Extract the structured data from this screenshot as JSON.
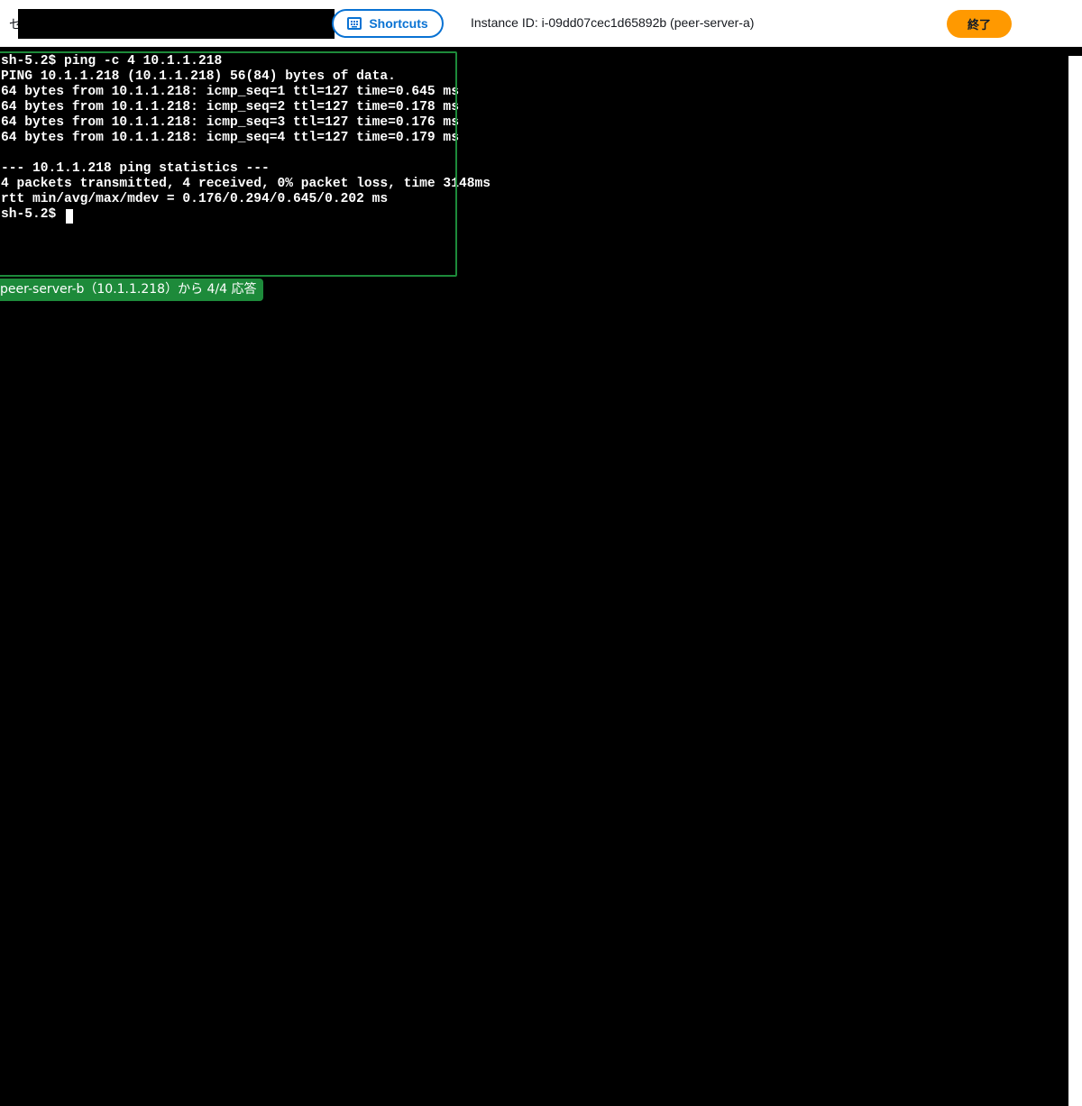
{
  "header": {
    "session_label": "セ",
    "shortcuts_label": "Shortcuts",
    "instance_info": "Instance ID: i-09dd07cec1d65892b (peer-server-a)",
    "terminate_label": "終了"
  },
  "colors": {
    "shortcuts_accent": "#0972d3",
    "terminate_button": "#ff9900",
    "highlight_green": "#1d8a3a",
    "terminal_background": "#000000",
    "terminal_text": "#ffffff"
  },
  "terminal": {
    "lines": [
      "sh-5.2$ ping -c 4 10.1.1.218",
      "PING 10.1.1.218 (10.1.1.218) 56(84) bytes of data.",
      "64 bytes from 10.1.1.218: icmp_seq=1 ttl=127 time=0.645 ms",
      "64 bytes from 10.1.1.218: icmp_seq=2 ttl=127 time=0.178 ms",
      "64 bytes from 10.1.1.218: icmp_seq=3 ttl=127 time=0.176 ms",
      "64 bytes from 10.1.1.218: icmp_seq=4 ttl=127 time=0.179 ms",
      "",
      "--- 10.1.1.218 ping statistics ---",
      "4 packets transmitted, 4 received, 0% packet loss, time 3148ms",
      "rtt min/avg/max/mdev = 0.176/0.294/0.645/0.202 ms",
      "sh-5.2$ "
    ]
  },
  "annotation": {
    "label": "peer-server-b（10.1.1.218）から 4/4 応答"
  }
}
